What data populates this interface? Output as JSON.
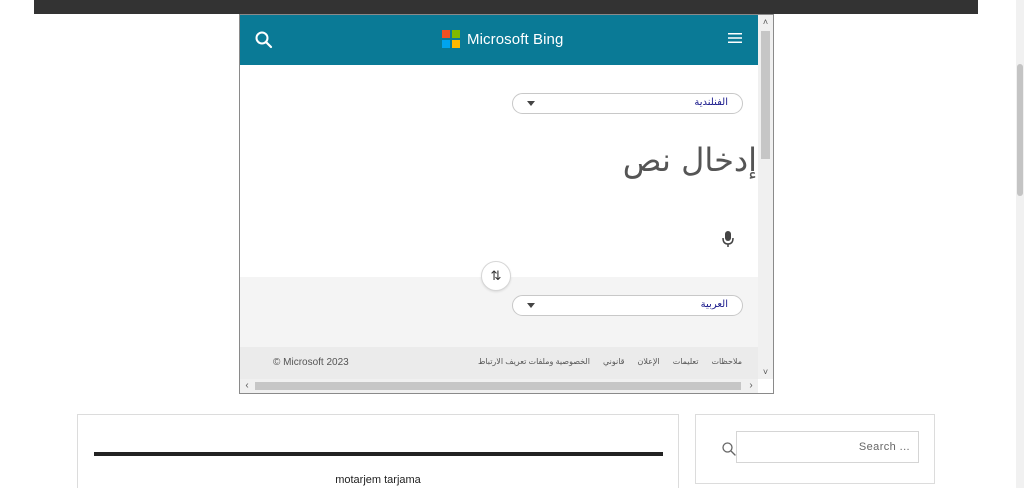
{
  "page": {
    "post": {
      "title": "motarjem tarjama"
    },
    "search": {
      "placeholder": "Search ...",
      "icon": "search-icon"
    }
  },
  "bing": {
    "brand": "Microsoft Bing",
    "colors": {
      "header": "#0a7a96",
      "logo": [
        "#f25022",
        "#7fba00",
        "#00a4ef",
        "#ffb900"
      ]
    },
    "source_language": "الفنلندية",
    "input_placeholder": "إدخال نص",
    "target_language": "العربية",
    "swap_label": "⇅",
    "footer": {
      "copyright": "© Microsoft 2023",
      "links": [
        "الخصوصية وملفات تعريف الارتباط",
        "قانوني",
        "الإعلان",
        "تعليمات",
        "ملاحظات"
      ]
    }
  }
}
